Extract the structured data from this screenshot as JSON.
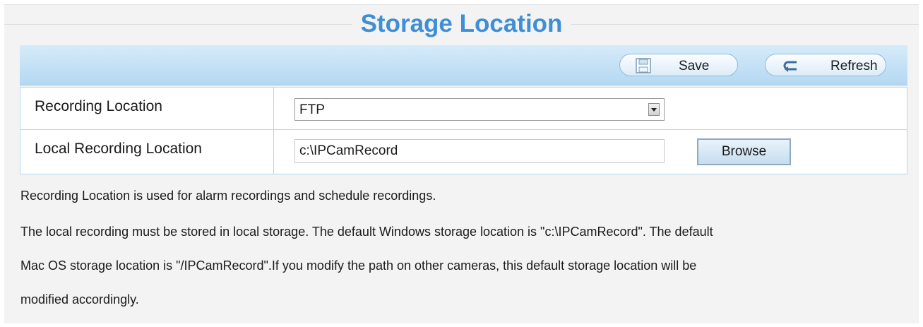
{
  "page": {
    "title": "Storage Location"
  },
  "toolbar": {
    "save_label": "Save",
    "refresh_label": "Refresh"
  },
  "form": {
    "recording_location": {
      "label": "Recording Location",
      "selected": "FTP"
    },
    "local_recording_location": {
      "label": "Local Recording Location",
      "value": "c:\\IPCamRecord",
      "browse_label": "Browse"
    }
  },
  "info": {
    "line1": "Recording Location is used for alarm recordings and schedule recordings.",
    "line2": "The local recording must be stored in local storage. The default Windows storage location is \"c:\\IPCamRecord\". The default",
    "line3": "Mac OS storage location is \"/IPCamRecord\".If you modify the path on other cameras, this default storage location will be",
    "line4": "modified accordingly."
  },
  "colors": {
    "title": "#3f8fd6",
    "toolbar_top": "#d6ebf9",
    "toolbar_bottom": "#b4d8f2",
    "border": "#b6d6ec",
    "background": "#f3f3f3"
  },
  "icons": {
    "save": "floppy-disk-icon",
    "refresh": "refresh-arrow-icon",
    "dropdown": "chevron-down-icon"
  }
}
